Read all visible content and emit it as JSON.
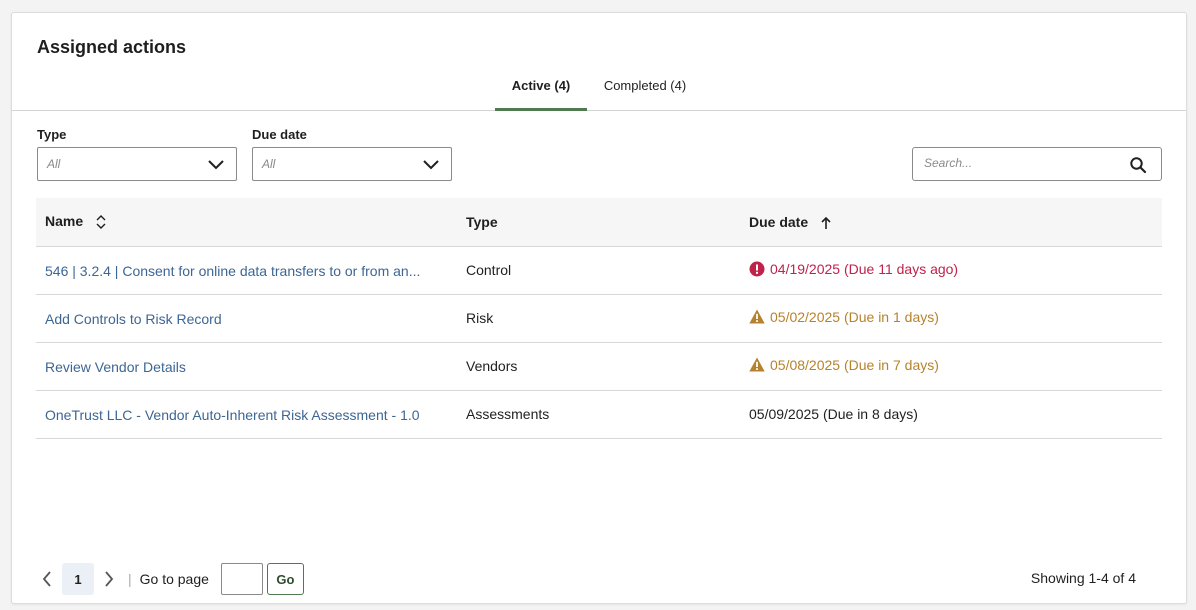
{
  "title": "Assigned actions",
  "tabs": [
    {
      "label": "Active (4)",
      "active": true
    },
    {
      "label": "Completed (4)",
      "active": false
    }
  ],
  "filters": {
    "type": {
      "label": "Type",
      "value": "All"
    },
    "due_date": {
      "label": "Due date",
      "value": "All"
    }
  },
  "search": {
    "placeholder": "Search..."
  },
  "table": {
    "columns": [
      "Name",
      "Type",
      "Due date"
    ],
    "rows": [
      {
        "name": "546 | 3.2.4 | Consent for online data transfers to or from an...",
        "type": "Control",
        "due": "04/19/2025 (Due 11 days ago)",
        "status": "overdue"
      },
      {
        "name": "Add Controls to Risk Record",
        "type": "Risk",
        "due": "05/02/2025 (Due in 1 days)",
        "status": "warning"
      },
      {
        "name": "Review Vendor Details",
        "type": "Vendors",
        "due": "05/08/2025 (Due in 7 days)",
        "status": "warning"
      },
      {
        "name": "OneTrust LLC - Vendor Auto-Inherent Risk Assessment - 1.0",
        "type": "Assessments",
        "due": "05/09/2025 (Due in 8 days)",
        "status": "normal"
      }
    ]
  },
  "pagination": {
    "current_page": "1",
    "goto_label": "Go to page",
    "go_label": "Go",
    "showing": "Showing 1-4 of 4"
  },
  "colors": {
    "overdue": "#c0224a",
    "warning": "#b7822e",
    "link": "#3d6694",
    "accent": "#4f7a4f"
  }
}
